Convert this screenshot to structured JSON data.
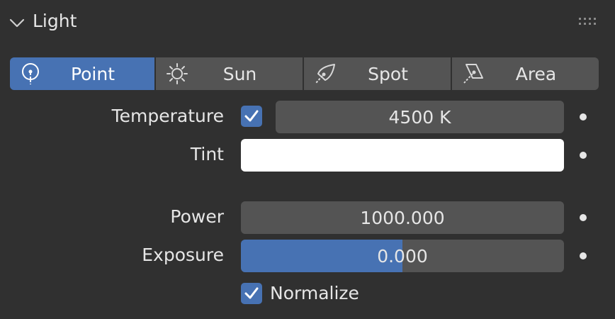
{
  "panel": {
    "title": "Light",
    "collapse_icon": "chevron-down-icon",
    "grip_icon": "drag-grip-icon"
  },
  "light_types": [
    {
      "label": "Point",
      "icon": "point-light-icon",
      "active": true
    },
    {
      "label": "Sun",
      "icon": "sun-light-icon",
      "active": false
    },
    {
      "label": "Spot",
      "icon": "spot-light-icon",
      "active": false
    },
    {
      "label": "Area",
      "icon": "area-light-icon",
      "active": false
    }
  ],
  "properties": {
    "temperature": {
      "label": "Temperature",
      "enabled": true,
      "value": "4500 K"
    },
    "tint": {
      "label": "Tint",
      "color": "#ffffff"
    },
    "power": {
      "label": "Power",
      "value": "1000.000"
    },
    "exposure": {
      "label": "Exposure",
      "value": "0.000",
      "fill_fraction": 0.5
    },
    "normalize": {
      "label": "Normalize",
      "checked": true
    }
  },
  "colors": {
    "background": "#303030",
    "field": "#545454",
    "accent": "#4772b3",
    "text": "#e6e6e6"
  }
}
